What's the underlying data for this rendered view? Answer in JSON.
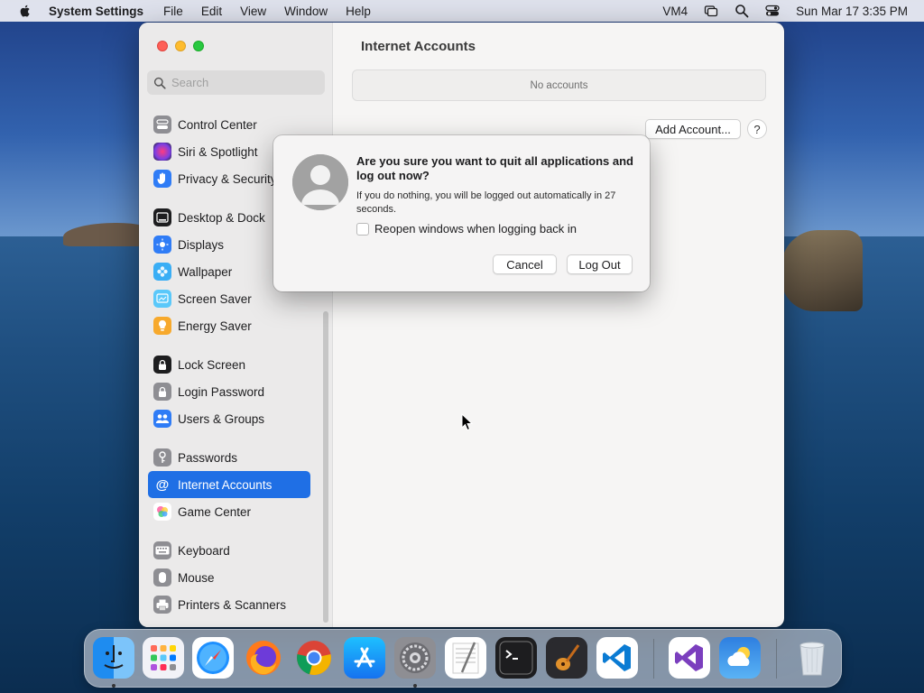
{
  "menubar": {
    "app_name": "System Settings",
    "menus": [
      "File",
      "Edit",
      "View",
      "Window",
      "Help"
    ],
    "vm_label": "VM4",
    "datetime": "Sun Mar 17  3:35 PM",
    "icons": [
      "apple-icon",
      "screen-mirroring-icon",
      "spotlight-search-icon",
      "control-center-icon"
    ]
  },
  "window": {
    "title": "Internet Accounts",
    "search_placeholder": "Search",
    "sidebar_items": [
      {
        "label": "Control Center",
        "icon": "control-center-icon",
        "color": "#8e8e93"
      },
      {
        "label": "Siri & Spotlight",
        "icon": "siri-icon",
        "color": "#b04fd6"
      },
      {
        "label": "Privacy & Security",
        "icon": "hand-icon",
        "color": "#2f7cf6"
      },
      {
        "label": "Desktop & Dock",
        "icon": "dock-icon",
        "color": "#1d1d1f"
      },
      {
        "label": "Displays",
        "icon": "sun-icon",
        "color": "#2f7cf6"
      },
      {
        "label": "Wallpaper",
        "icon": "flower-icon",
        "color": "#3aaef5"
      },
      {
        "label": "Screen Saver",
        "icon": "screen-saver-icon",
        "color": "#5ac8fa"
      },
      {
        "label": "Energy Saver",
        "icon": "lightbulb-icon",
        "color": "#f7a92c"
      },
      {
        "label": "Lock Screen",
        "icon": "lock-icon",
        "color": "#1d1d1f"
      },
      {
        "label": "Login Password",
        "icon": "lock-icon",
        "color": "#8e8e93"
      },
      {
        "label": "Users & Groups",
        "icon": "users-icon",
        "color": "#2f7cf6"
      },
      {
        "label": "Passwords",
        "icon": "key-icon",
        "color": "#8e8e93"
      },
      {
        "label": "Internet Accounts",
        "icon": "at-icon",
        "color": "#1f6fe5",
        "selected": true
      },
      {
        "label": "Game Center",
        "icon": "game-center-icon",
        "color": "#ffffff"
      },
      {
        "label": "Keyboard",
        "icon": "keyboard-icon",
        "color": "#8e8e93"
      },
      {
        "label": "Mouse",
        "icon": "mouse-icon",
        "color": "#8e8e93"
      },
      {
        "label": "Printers & Scanners",
        "icon": "printer-icon",
        "color": "#8e8e93"
      }
    ],
    "no_accounts": "No accounts",
    "add_account_label": "Add Account...",
    "help_label": "?"
  },
  "dialog": {
    "title": "Are you sure you want to quit all applications and log out now?",
    "message": "If you do nothing, you will be logged out automatically in 27 seconds.",
    "checkbox_label": "Reopen windows when logging back in",
    "checkbox_checked": false,
    "cancel_label": "Cancel",
    "logout_label": "Log Out"
  },
  "dock": {
    "apps": [
      {
        "name": "Finder",
        "icon": "finder-icon",
        "running": true
      },
      {
        "name": "Launchpad",
        "icon": "launchpad-icon",
        "running": false
      },
      {
        "name": "Safari",
        "icon": "safari-icon",
        "running": false
      },
      {
        "name": "Firefox",
        "icon": "firefox-icon",
        "running": false
      },
      {
        "name": "Chrome",
        "icon": "chrome-icon",
        "running": false
      },
      {
        "name": "App Store",
        "icon": "app-store-icon",
        "running": false
      },
      {
        "name": "System Settings",
        "icon": "system-settings-icon",
        "running": true
      },
      {
        "name": "TextEdit",
        "icon": "textedit-icon",
        "running": false
      },
      {
        "name": "Terminal",
        "icon": "terminal-icon",
        "running": false
      },
      {
        "name": "GarageBand",
        "icon": "garageband-icon",
        "running": false
      },
      {
        "name": "VS Code",
        "icon": "vscode-icon",
        "running": false
      },
      {
        "name": "Visual Studio",
        "icon": "visual-studio-icon",
        "running": false
      },
      {
        "name": "Weather",
        "icon": "weather-icon",
        "running": false
      },
      {
        "name": "Trash",
        "icon": "trash-icon",
        "running": false
      }
    ]
  }
}
